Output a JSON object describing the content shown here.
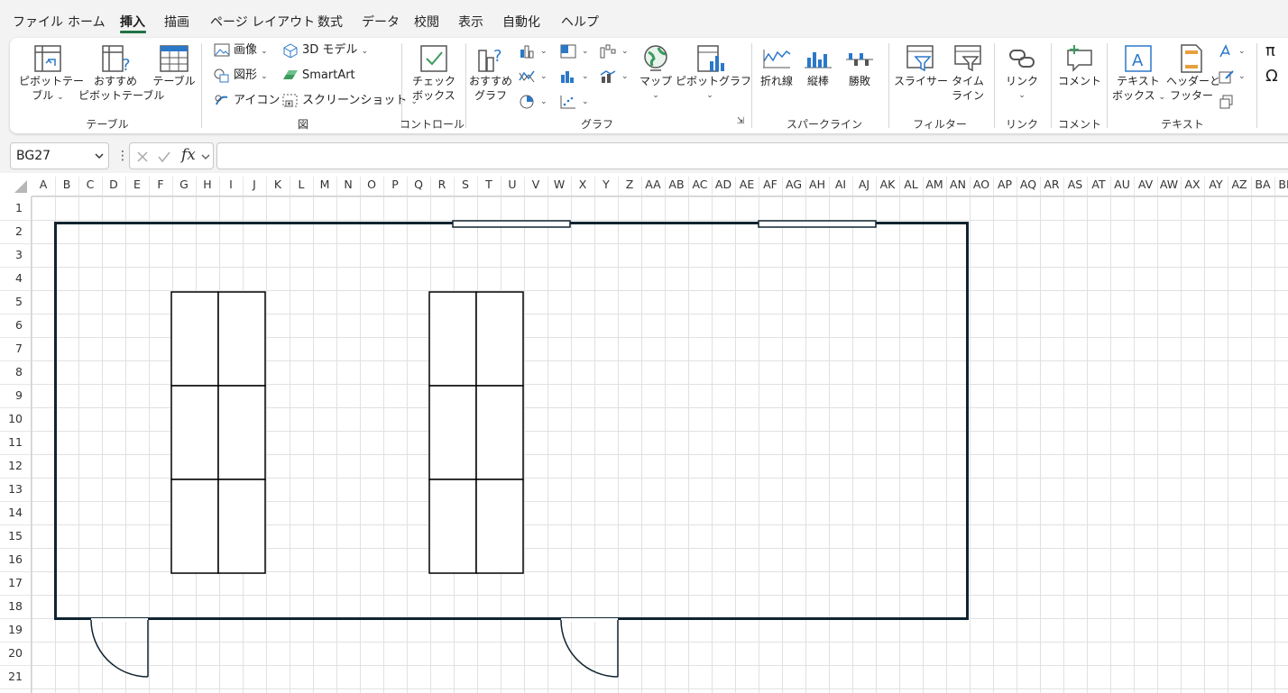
{
  "menu": {
    "tabs": [
      "ファイル",
      "ホーム",
      "挿入",
      "描画",
      "ページ レイアウト",
      "数式",
      "データ",
      "校閲",
      "表示",
      "自動化",
      "ヘルプ"
    ],
    "active_index": 2
  },
  "ribbon": {
    "groups": {
      "table": "テーブル",
      "illustrations": "図",
      "controls": "コントロール",
      "charts": "グラフ",
      "sparklines": "スパークライン",
      "filters": "フィルター",
      "links": "リンク",
      "comments": "コメント",
      "text": "テキスト"
    },
    "buttons": {
      "pivot_table_1": "ピボットテー",
      "pivot_table_2": "ブル",
      "recommended_pivot_1": "おすすめ",
      "recommended_pivot_2": "ピボットテーブル",
      "table": "テーブル",
      "picture": "画像",
      "shapes": "図形",
      "icons": "アイコン",
      "model_3d": "3D モデル",
      "smartart": "SmartArt",
      "screenshot": "スクリーンショット",
      "checkbox_1": "チェック",
      "checkbox_2": "ボックス",
      "recommended_charts_1": "おすすめ",
      "recommended_charts_2": "グラフ",
      "maps": "マップ",
      "pivot_chart": "ピボットグラフ",
      "line": "折れ線",
      "column": "縦棒",
      "win_loss": "勝敗",
      "slicer": "スライサー",
      "timeline_1": "タイム",
      "timeline_2": "ライン",
      "link": "リンク",
      "comment": "コメント",
      "textbox_1": "テキスト",
      "textbox_2": "ボックス",
      "header_footer_1": "ヘッダーと",
      "header_footer_2": "フッター"
    }
  },
  "formula_bar": {
    "name_box": "BG27",
    "fx": "fx",
    "formula": ""
  },
  "sheet": {
    "columns": [
      "A",
      "B",
      "C",
      "D",
      "E",
      "F",
      "G",
      "H",
      "I",
      "J",
      "K",
      "L",
      "M",
      "N",
      "O",
      "P",
      "Q",
      "R",
      "S",
      "T",
      "U",
      "V",
      "W",
      "X",
      "Y",
      "Z",
      "AA",
      "AB",
      "AC",
      "AD",
      "AE",
      "AF",
      "AG",
      "AH",
      "AI",
      "AJ",
      "AK",
      "AL",
      "AM",
      "AN",
      "AO",
      "AP",
      "AQ",
      "AR",
      "AS",
      "AT",
      "AU",
      "AV",
      "AW",
      "AX",
      "AY",
      "AZ",
      "BA",
      "BB"
    ],
    "rows": [
      "1",
      "2",
      "3",
      "4",
      "5",
      "6",
      "7",
      "8",
      "9",
      "10",
      "11",
      "12",
      "13",
      "14",
      "15",
      "16",
      "17",
      "18",
      "19",
      "20",
      "21"
    ]
  },
  "colors": {
    "accent": "#217346",
    "room_outline": "#0f2430",
    "grid_line": "#e1e1e1"
  }
}
